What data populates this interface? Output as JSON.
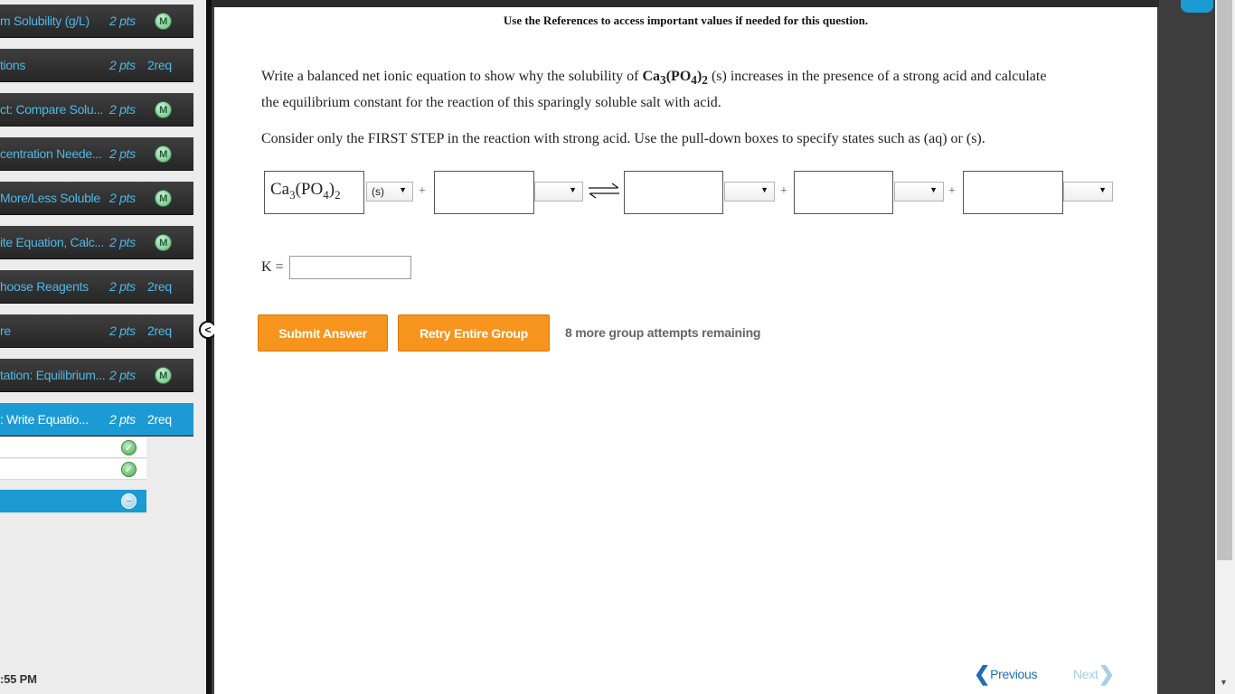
{
  "sidebar": {
    "items": [
      {
        "title": "m Solubility (g/L)",
        "pts": "2 pts",
        "badge": "M"
      },
      {
        "title": "tions",
        "pts": "2 pts",
        "req": "2req"
      },
      {
        "title": "ct: Compare Solu...",
        "pts": "2 pts",
        "badge": "M"
      },
      {
        "title": "centration Neede...",
        "pts": "2 pts",
        "badge": "M"
      },
      {
        "title": "More/Less Soluble",
        "pts": "2 pts",
        "badge": "M"
      },
      {
        "title": "ite Equation, Calc...",
        "pts": "2 pts",
        "badge": "M"
      },
      {
        "title": "hoose Reagents",
        "pts": "2 pts",
        "req": "2req"
      },
      {
        "title": "re",
        "pts": "2 pts",
        "req": "2req"
      },
      {
        "title": "tation: Equilibrium...",
        "pts": "2 pts",
        "badge": "M"
      },
      {
        "title": ": Write Equatio...",
        "pts": "2 pts",
        "req": "2req"
      }
    ],
    "clock": ":55 PM"
  },
  "main": {
    "references_note": "Use the References to access important values if needed for this question.",
    "question_part1": "Write a balanced net ionic equation to show why the solubility of",
    "question_part2": "(s) increases in the presence of a strong acid and calculate",
    "question_line2": "the equilibrium constant for the reaction of this sparingly soluble salt with acid.",
    "instruction": "Consider only the FIRST STEP in the reaction with strong acid. Use the pull-down boxes to specify states such as (aq) or (s).",
    "equation": {
      "reactant_formula": "Ca3(PO4)2",
      "reactant_state": "(s)",
      "plus": "+",
      "state_placeholder": ""
    },
    "k_label": "K =",
    "submit_label": "Submit Answer",
    "retry_label": "Retry Entire Group",
    "attempts_text": "8 more group attempts remaining",
    "previous_label": "Previous",
    "next_label": "Next"
  },
  "colors": {
    "accent_blue": "#1b9ad3",
    "button_orange": "#f7941d"
  }
}
